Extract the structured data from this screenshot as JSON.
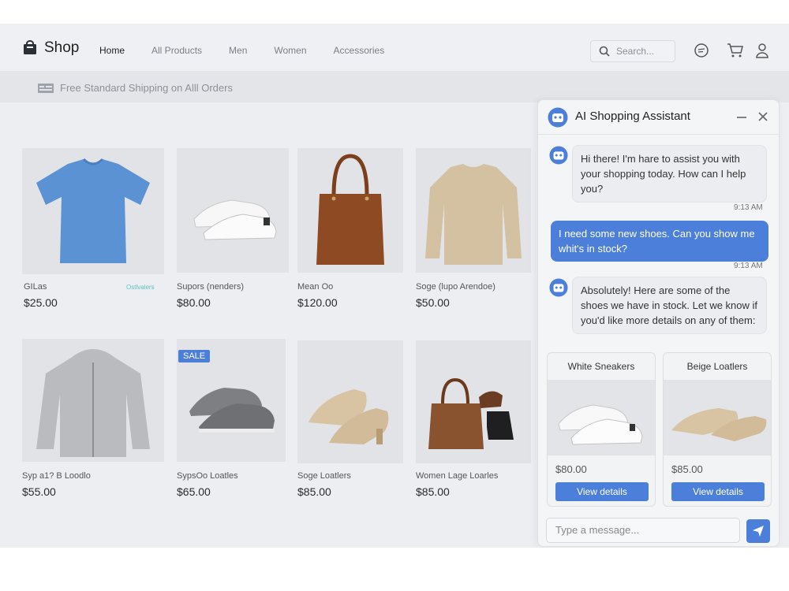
{
  "nav": {
    "logo": "Shop",
    "links": [
      "Home",
      "All Products",
      "Men",
      "Women",
      "Accessories"
    ],
    "search_placeholder": "Search..."
  },
  "banner": {
    "text": "Free Standard Shipping on Alll Orders"
  },
  "products": [
    {
      "name": "GILas",
      "tag": "Ostlvalers",
      "price": "$25.00",
      "image": "blue-tshirt"
    },
    {
      "name": "Supors (nenders)",
      "price": "$80.00",
      "image": "white-sneakers"
    },
    {
      "name": "Mean Oo",
      "price": "$120.00",
      "image": "brown-tote-bag"
    },
    {
      "name": "Soge (lupo Arendoe)",
      "price": "$50.00",
      "image": "beige-sweater"
    },
    {
      "name": "Syp a1? B Loodlo",
      "price": "$55.00",
      "image": "grey-hoodie"
    },
    {
      "name": "SypsOo Loatles",
      "price": "$65.00",
      "image": "grey-sneakers",
      "badge": "SALE"
    },
    {
      "name": "Soge Loatlers",
      "price": "$85.00",
      "image": "beige-loafers"
    },
    {
      "name": "Women Lage Loarles",
      "price": "$85.00",
      "image": "bag-and-shoes"
    }
  ],
  "chat": {
    "title": "AI Shopping Assistant",
    "messages": [
      {
        "from": "bot",
        "text": "Hi there! I'm hare to assist you with your shopping today. How can I help you?",
        "time": "9:13 AM"
      },
      {
        "from": "user",
        "text": "I need some new shoes. Can you show me whit's in stock?",
        "time": "9:13 AM"
      },
      {
        "from": "bot",
        "text": "Absolutely! Here are some of the shoes we have in stock. Let we know if you'd like more details on any of them:"
      }
    ],
    "cards": [
      {
        "title": "White Sneakers",
        "price": "$80.00",
        "button": "View details"
      },
      {
        "title": "Beige Loatlers",
        "price": "$85.00",
        "button": "View details"
      }
    ],
    "input_placeholder": "Type a message..."
  },
  "colors": {
    "accent": "#4c7fda",
    "background": "#eceef2",
    "tag": "#5cc2c7"
  },
  "icons": [
    "bag-logo-icon",
    "search-icon",
    "chat-icon",
    "cart-icon",
    "user-icon",
    "shipping-icon",
    "bot-avatar-icon",
    "minimize-icon",
    "close-icon",
    "send-icon"
  ]
}
